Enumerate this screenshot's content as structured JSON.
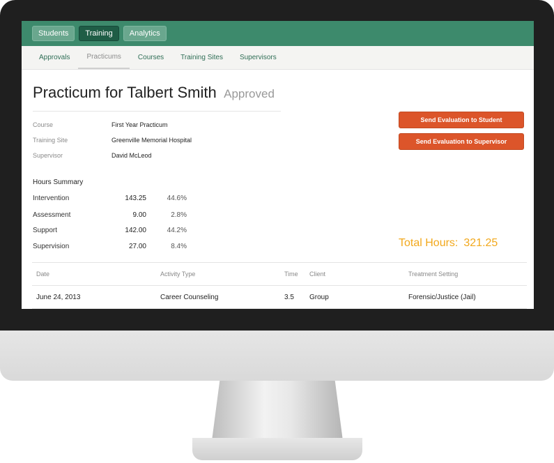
{
  "topnav": {
    "items": [
      "Students",
      "Training",
      "Analytics"
    ],
    "active_index": 1
  },
  "subnav": {
    "items": [
      "Approvals",
      "Practicums",
      "Courses",
      "Training Sites",
      "Supervisors"
    ],
    "active_index": 1
  },
  "header": {
    "title": "Practicum for Talbert Smith",
    "status": "Approved"
  },
  "details": [
    {
      "label": "Course",
      "value": "First Year Practicum"
    },
    {
      "label": "Training Site",
      "value": "Greenville Memorial Hospital"
    },
    {
      "label": "Supervisor",
      "value": "David McLeod"
    }
  ],
  "actions": {
    "send_student": "Send Evaluation to Student",
    "send_supervisor": "Send Evaluation to Supervisor"
  },
  "hours_summary": {
    "title": "Hours Summary",
    "rows": [
      {
        "category": "Intervention",
        "hours": "143.25",
        "percent": "44.6%"
      },
      {
        "category": "Assessment",
        "hours": "9.00",
        "percent": "2.8%"
      },
      {
        "category": "Support",
        "hours": "142.00",
        "percent": "44.2%"
      },
      {
        "category": "Supervision",
        "hours": "27.00",
        "percent": "8.4%"
      }
    ],
    "total_label": "Total Hours:",
    "total_value": "321.25"
  },
  "activity_table": {
    "columns": [
      "Date",
      "Activity Type",
      "Time",
      "Client",
      "Treatment Setting"
    ],
    "rows": [
      [
        "June 24, 2013",
        "Career Counseling",
        "3.5",
        "Group",
        "Forensic/Justice (Jail)"
      ]
    ]
  },
  "colors": {
    "nav_green": "#3d8a6c",
    "action_orange": "#dc552a",
    "total_amber": "#f2a81c"
  }
}
